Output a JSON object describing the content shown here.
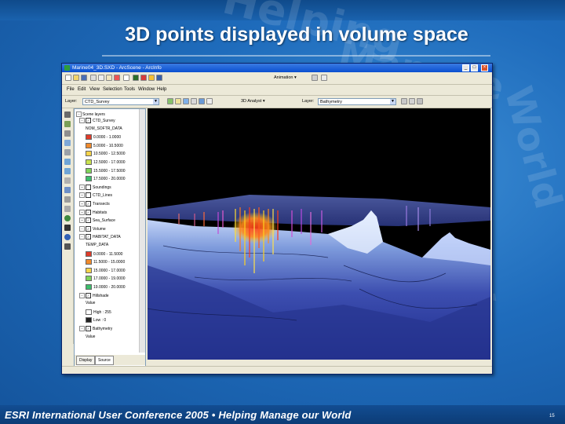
{
  "slide": {
    "title": "3D points displayed in volume space",
    "footer": "ESRI International User Conference 2005 • Helping Manage our World",
    "page_number": "15",
    "watermark_words": [
      "Helping",
      "Manage",
      "our",
      "World"
    ]
  },
  "colors": {
    "slide_blue": "#1f6cbc",
    "titlebar_blue": "#0a4fd0",
    "window_face": "#ece9d8",
    "viewer_background": "#000000",
    "terrain_high": "#ffffff",
    "terrain_low": "#1d2a8c",
    "points_hot": "#ff3a1a",
    "points_warm": "#ffd21f"
  },
  "window": {
    "title": "Marine04_3D.SXD - ArcScene - ArcInfo",
    "minimize_glyph": "_",
    "maximize_glyph": "□",
    "close_glyph": "×"
  },
  "toolbar_top": {
    "animation_label": "Animation ▾"
  },
  "menu": {
    "items": [
      "File",
      "Edit",
      "View",
      "Selection",
      "Tools",
      "Window",
      "Help"
    ]
  },
  "toolbar_layers": {
    "layer_label": "Layer:",
    "layer_value": "CTD_Survey",
    "analyst_label": "3D Analyst ▾",
    "analyst_layer_label": "Layer:",
    "analyst_layer_value": "Bathymetry"
  },
  "toc": {
    "root": "Scene layers",
    "rows": [
      {
        "indent": 1,
        "expand": "−",
        "checked": true,
        "text": "CTD_Survey"
      },
      {
        "indent": 3,
        "text": "NOM_SOFTR_DATA"
      },
      {
        "indent": 3,
        "swatch": "#e03c2a",
        "text": "0.0000 - 1.0000"
      },
      {
        "indent": 3,
        "swatch": "#f08a2c",
        "text": "5.0000 - 10.5000"
      },
      {
        "indent": 3,
        "swatch": "#f5d34a",
        "text": "10.5000 - 12.5000"
      },
      {
        "indent": 3,
        "swatch": "#c9e24f",
        "text": "12.5000 - 17.0000"
      },
      {
        "indent": 3,
        "swatch": "#7fd35a",
        "text": "15.5000 - 17.5000"
      },
      {
        "indent": 3,
        "swatch": "#3cbd6c",
        "text": "17.5000 - 20.0000"
      },
      {
        "indent": 1,
        "expand": "+",
        "checked": false,
        "text": "Soundings"
      },
      {
        "indent": 1,
        "expand": "+",
        "checked": false,
        "text": "CTD_Lines"
      },
      {
        "indent": 1,
        "expand": "+",
        "checked": true,
        "text": "Transects"
      },
      {
        "indent": 1,
        "expand": "+",
        "checked": true,
        "text": "Habitats"
      },
      {
        "indent": 1,
        "expand": "+",
        "checked": true,
        "text": "Sea_Surface"
      },
      {
        "indent": 1,
        "expand": "−",
        "checked": true,
        "text": "Volume"
      },
      {
        "indent": 1,
        "expand": "−",
        "checked": true,
        "text": "HABITAT_DATA"
      },
      {
        "indent": 3,
        "text": "TEMP_DATA"
      },
      {
        "indent": 3,
        "swatch": "#e03c2a",
        "text": "0.0000 - 11.5000"
      },
      {
        "indent": 3,
        "swatch": "#f08a2c",
        "text": "11.5000 - 15.0000"
      },
      {
        "indent": 3,
        "swatch": "#f5d34a",
        "text": "15.0000 - 17.0000"
      },
      {
        "indent": 3,
        "swatch": "#7fd35a",
        "text": "17.0000 - 19.0000"
      },
      {
        "indent": 3,
        "swatch": "#3cbd6c",
        "text": "19.0000 - 20.0000"
      },
      {
        "indent": 1,
        "expand": "−",
        "checked": true,
        "text": "Hillshade"
      },
      {
        "indent": 3,
        "text": "Value"
      },
      {
        "indent": 3,
        "swatch": "#ffffff",
        "text": "High : 255"
      },
      {
        "indent": 3,
        "swatch": "#222222",
        "text": "Low : 0"
      },
      {
        "indent": 1,
        "expand": "−",
        "checked": true,
        "text": "Bathymetry"
      },
      {
        "indent": 3,
        "text": "Value"
      }
    ],
    "tab_display": "Display",
    "tab_source": "Source"
  }
}
